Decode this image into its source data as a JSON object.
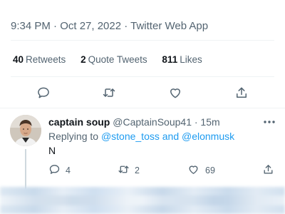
{
  "tweet": {
    "timestamp_line": "9:34 PM · Oct 27, 2022 · Twitter Web App",
    "stats": {
      "retweets_count": "40",
      "retweets_label": "Retweets",
      "quotes_count": "2",
      "quotes_label": "Quote Tweets",
      "likes_count": "811",
      "likes_label": "Likes"
    },
    "actions": [
      "comment-icon",
      "retweet-icon",
      "like-icon",
      "share-icon"
    ]
  },
  "reply": {
    "display_name": "captain soup",
    "handle_time": "@CaptainSoup41 · 15m",
    "replying_prefix": "Replying to",
    "mention_1": "@stone_toss",
    "joiner": "and",
    "mention_2": "@elonmusk",
    "text": "N",
    "reply_count": "4",
    "retweet_count": "2",
    "like_count": "69"
  },
  "colors": {
    "text_primary": "#0f1419",
    "text_secondary": "#536471",
    "accent": "#1d9bf0",
    "divider": "#eff3f4"
  }
}
